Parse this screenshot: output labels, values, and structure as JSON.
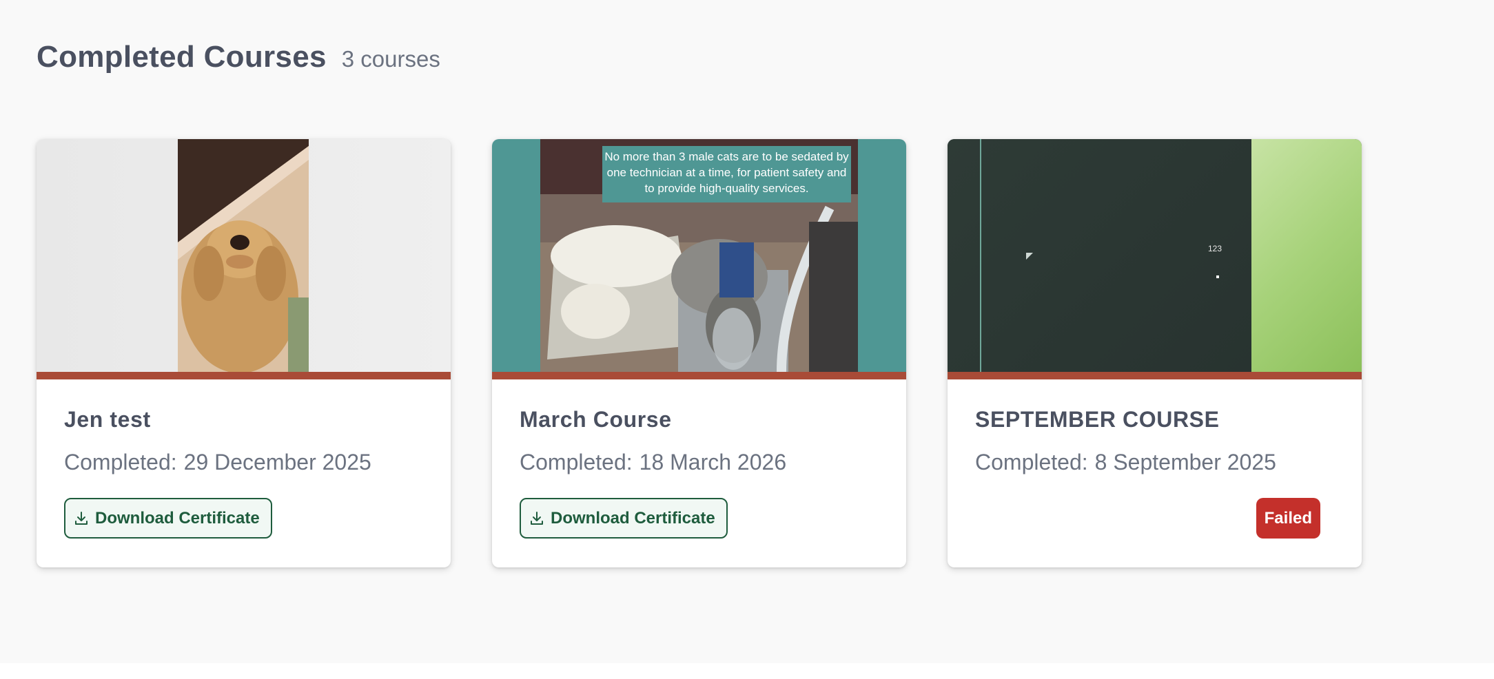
{
  "header": {
    "title": "Completed Courses",
    "count": "3 courses"
  },
  "courses": [
    {
      "title": "Jen test",
      "completed_label": "Completed:",
      "completed_date": "29 December 2025",
      "action_label": "Download Certificate",
      "thumbnail": "dog-photo"
    },
    {
      "title": "March Course",
      "completed_label": "Completed:",
      "completed_date": "18 March 2026",
      "action_label": "Download Certificate",
      "thumbnail": "cats-on-table-photo",
      "thumbnail_caption": "No more than 3 male cats are to be sedated by one technician at a time, for patient safety and to provide high-quality services."
    },
    {
      "title": "SEPTEMBER COURSE",
      "completed_label": "Completed:",
      "completed_date": "8 September 2025",
      "status_label": "Failed",
      "thumbnail": "slide-preview",
      "thumbnail_slide_number": "123"
    }
  ],
  "colors": {
    "accent_bar": "#a94b37",
    "download_green": "#1e5c3d",
    "failed_red": "#c4302b",
    "title_text": "#4a5060",
    "muted_text": "#6b7280"
  },
  "icons": {
    "download": "download-icon"
  }
}
